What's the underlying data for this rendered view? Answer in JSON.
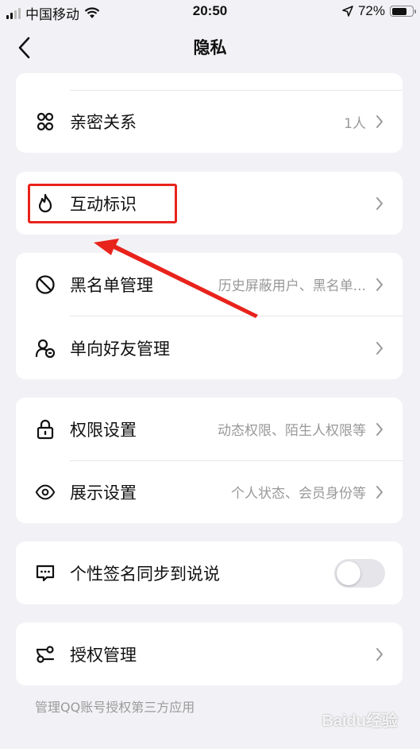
{
  "status_bar": {
    "carrier": "中国移动",
    "time": "20:50",
    "battery": "72%",
    "battery_level": 0.72
  },
  "nav": {
    "title": "隐私"
  },
  "groups": {
    "intimate": {
      "label": "亲密关系",
      "value": "1人"
    },
    "interaction": {
      "label": "互动标识"
    },
    "blacklist": {
      "label": "黑名单管理",
      "value": "历史屏蔽用户、黑名单..."
    },
    "oneway": {
      "label": "单向好友管理"
    },
    "permission": {
      "label": "权限设置",
      "value": "动态权限、陌生人权限等"
    },
    "display": {
      "label": "展示设置",
      "value": "个人状态、会员身份等"
    },
    "signature": {
      "label": "个性签名同步到说说",
      "enabled": false
    },
    "auth": {
      "label": "授权管理"
    }
  },
  "footnote": "管理QQ账号授权第三方应用",
  "watermark": "Baidu经验",
  "colors": {
    "highlight": "#e8231c",
    "background": "#f2f2f6"
  }
}
